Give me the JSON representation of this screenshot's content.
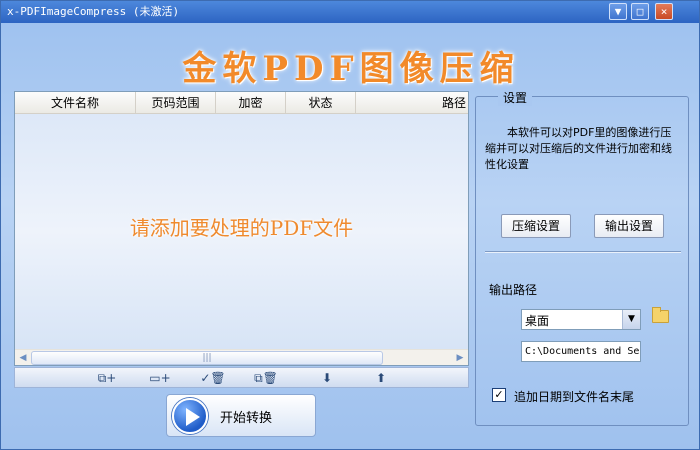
{
  "window": {
    "title": "x-PDFImageCompress (未激活)",
    "controls": {
      "minimize": "▼",
      "maximize": "□",
      "close": "×"
    }
  },
  "app_title": "金软PDF图像压缩",
  "file_list": {
    "columns": [
      "文件名称",
      "页码范围",
      "加密",
      "状态",
      "路径"
    ],
    "empty_hint": "请添加要处理的PDF文件",
    "scroll": {
      "left": "◀",
      "right": "▶",
      "thumb": "|||"
    }
  },
  "toolbar": {
    "icons": [
      "add-file-icon",
      "add-folder-icon",
      "remove-checked-icon",
      "remove-all-icon",
      "move-down-icon",
      "move-up-icon"
    ],
    "glyphs": [
      "⧉+",
      "▭+",
      "✓🗑",
      "⧉🗑",
      "⬇",
      "⬆"
    ]
  },
  "start_button": {
    "label": "开始转换"
  },
  "settings": {
    "legend": "设置",
    "description": "本软件可以对PDF里的图像进行压缩并可以对压缩后的文件进行加密和线性化设置",
    "compress_settings_label": "压缩设置",
    "output_settings_label": "输出设置",
    "output_path_label": "输出路径",
    "output_location_value": "桌面",
    "output_path_value": "C:\\Documents and Se",
    "append_date_label": "追加日期到文件名末尾",
    "append_date_checked": "✓"
  }
}
